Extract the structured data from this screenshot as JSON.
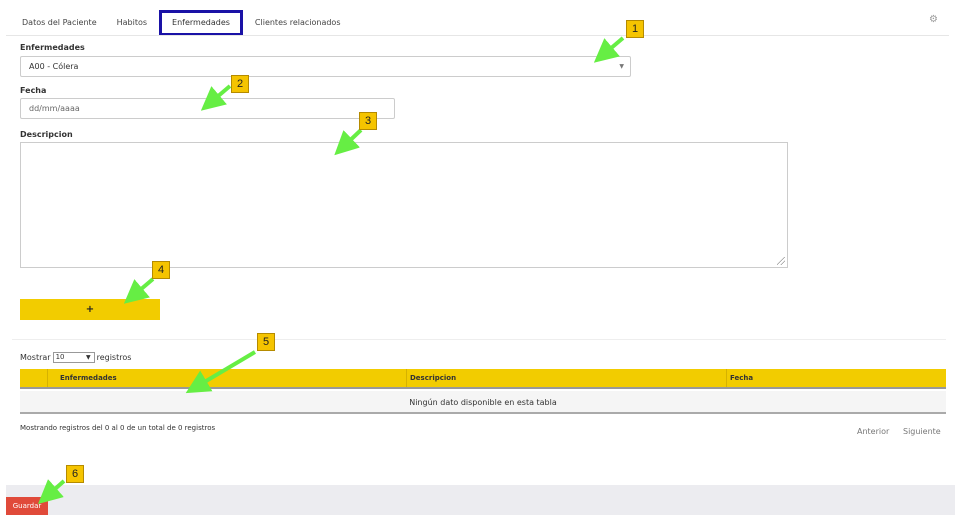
{
  "tabs": [
    {
      "label": "Datos del Paciente"
    },
    {
      "label": "Habitos"
    },
    {
      "label": "Enfermedades"
    },
    {
      "label": "Clientes relacionados"
    }
  ],
  "form": {
    "enfermedades_label": "Enfermedades",
    "enfermedades_value": "A00 - Cólera",
    "fecha_label": "Fecha",
    "fecha_placeholder": "dd/mm/aaaa",
    "descripcion_label": "Descripcion",
    "add_button": "+"
  },
  "table": {
    "show_label": "Mostrar",
    "length_value": "10",
    "records_label": "registros",
    "columns": [
      "Enfermedades",
      "Descripcion",
      "Fecha"
    ],
    "empty_text": "Ningún dato disponible en esta tabla",
    "info": "Mostrando registros del 0 al 0 de un total de 0 registros",
    "prev": "Anterior",
    "next": "Siguiente"
  },
  "footer": {
    "save_button": "Guardar"
  },
  "markers": [
    "1",
    "2",
    "3",
    "4",
    "5",
    "6"
  ],
  "colors": {
    "accent": "#f2cc00",
    "save": "#e04a3a",
    "active_tab_border": "#1a12a6",
    "arrow": "#66ee44"
  }
}
